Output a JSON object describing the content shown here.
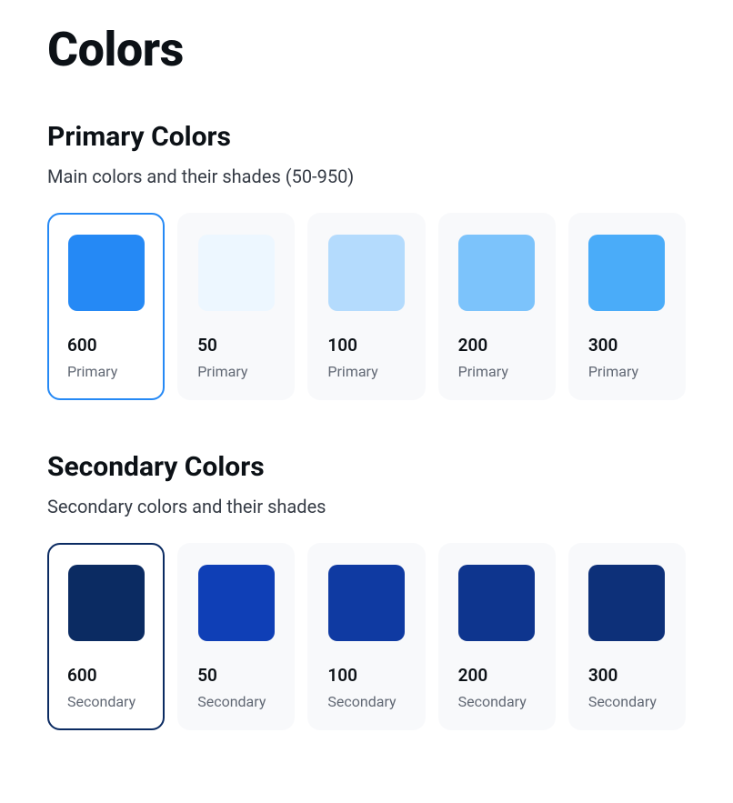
{
  "page": {
    "title": "Colors"
  },
  "sections": {
    "primary": {
      "heading": "Primary Colors",
      "description": "Main colors and their shades (50-950)",
      "palette_label": "Primary",
      "accent": "#2589f5",
      "swatches": [
        {
          "shade": "600",
          "color": "#2589f5",
          "selected": true
        },
        {
          "shade": "50",
          "color": "#edf7ff",
          "selected": false
        },
        {
          "shade": "100",
          "color": "#b4dbfd",
          "selected": false
        },
        {
          "shade": "200",
          "color": "#7cc3fb",
          "selected": false
        },
        {
          "shade": "300",
          "color": "#4aacf9",
          "selected": false
        }
      ]
    },
    "secondary": {
      "heading": "Secondary Colors",
      "description": "Secondary colors and their shades",
      "palette_label": "Secondary",
      "accent": "#0b2b62",
      "swatches": [
        {
          "shade": "600",
          "color": "#0b2b62",
          "selected": true
        },
        {
          "shade": "50",
          "color": "#0f3fb6",
          "selected": false
        },
        {
          "shade": "100",
          "color": "#0f3aa2",
          "selected": false
        },
        {
          "shade": "200",
          "color": "#0e358e",
          "selected": false
        },
        {
          "shade": "300",
          "color": "#0d3079",
          "selected": false
        }
      ]
    }
  }
}
